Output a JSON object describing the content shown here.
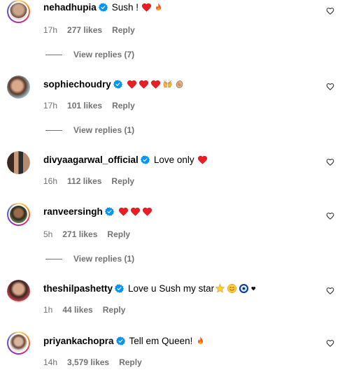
{
  "comments": [
    {
      "username": "nehadhupia",
      "text": "Sush !",
      "emojis": [
        "heart-icon",
        "fire-icon"
      ],
      "time": "17h",
      "likes": "277 likes",
      "reply": "Reply",
      "view_replies": "View replies (7)"
    },
    {
      "username": "sophiechoudry",
      "text": "",
      "emojis": [
        "heart-icon",
        "heart-icon",
        "heart-icon",
        "raised-hands-icon",
        "clap-icon"
      ],
      "time": "17h",
      "likes": "101 likes",
      "reply": "Reply",
      "view_replies": "View replies (1)"
    },
    {
      "username": "divyaagarwal_official",
      "text": "Love only",
      "emojis": [
        "heart-icon"
      ],
      "time": "16h",
      "likes": "112 likes",
      "reply": "Reply"
    },
    {
      "username": "ranveersingh",
      "text": "",
      "emojis": [
        "heart-icon",
        "heart-icon",
        "heart-icon"
      ],
      "time": "5h",
      "likes": "271 likes",
      "reply": "Reply",
      "view_replies": "View replies (1)"
    },
    {
      "username": "theshilpashetty",
      "text": "Love u Sush my star",
      "emojis": [
        "star-icon",
        "smiling-face-icon",
        "evil-eye-icon",
        "small-heart-icon"
      ],
      "time": "1h",
      "likes": "44 likes",
      "reply": "Reply"
    },
    {
      "username": "priyankachopra",
      "text": "Tell em Queen!",
      "emojis": [
        "fire-icon"
      ],
      "time": "14h",
      "likes": "3,579 likes",
      "reply": "Reply"
    }
  ],
  "colors": {
    "verified": "#0095f6",
    "heart": "#ed1c24",
    "meta": "#737373"
  }
}
